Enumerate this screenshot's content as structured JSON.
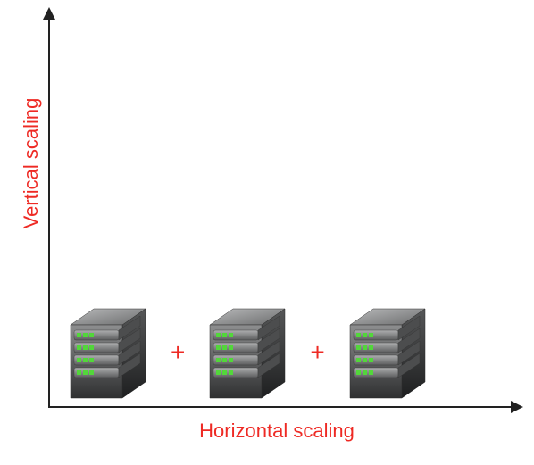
{
  "axes": {
    "y_label": "Vertical scaling",
    "x_label": "Horizontal scaling"
  },
  "operators": {
    "plus1": "+",
    "plus2": "+"
  },
  "colors": {
    "accent": "#ee2a24",
    "axis": "#222222",
    "server_body_light": "#868788",
    "server_body_dark": "#3d3e3f",
    "server_led": "#52d63a"
  },
  "chart_data": {
    "type": "diagram",
    "title": "",
    "xlabel": "Horizontal scaling",
    "ylabel": "Vertical scaling",
    "x": [
      1,
      2,
      3
    ],
    "series": [
      {
        "name": "server",
        "values": [
          "server",
          "server",
          "server"
        ]
      }
    ],
    "annotations": [
      "+",
      "+"
    ]
  }
}
